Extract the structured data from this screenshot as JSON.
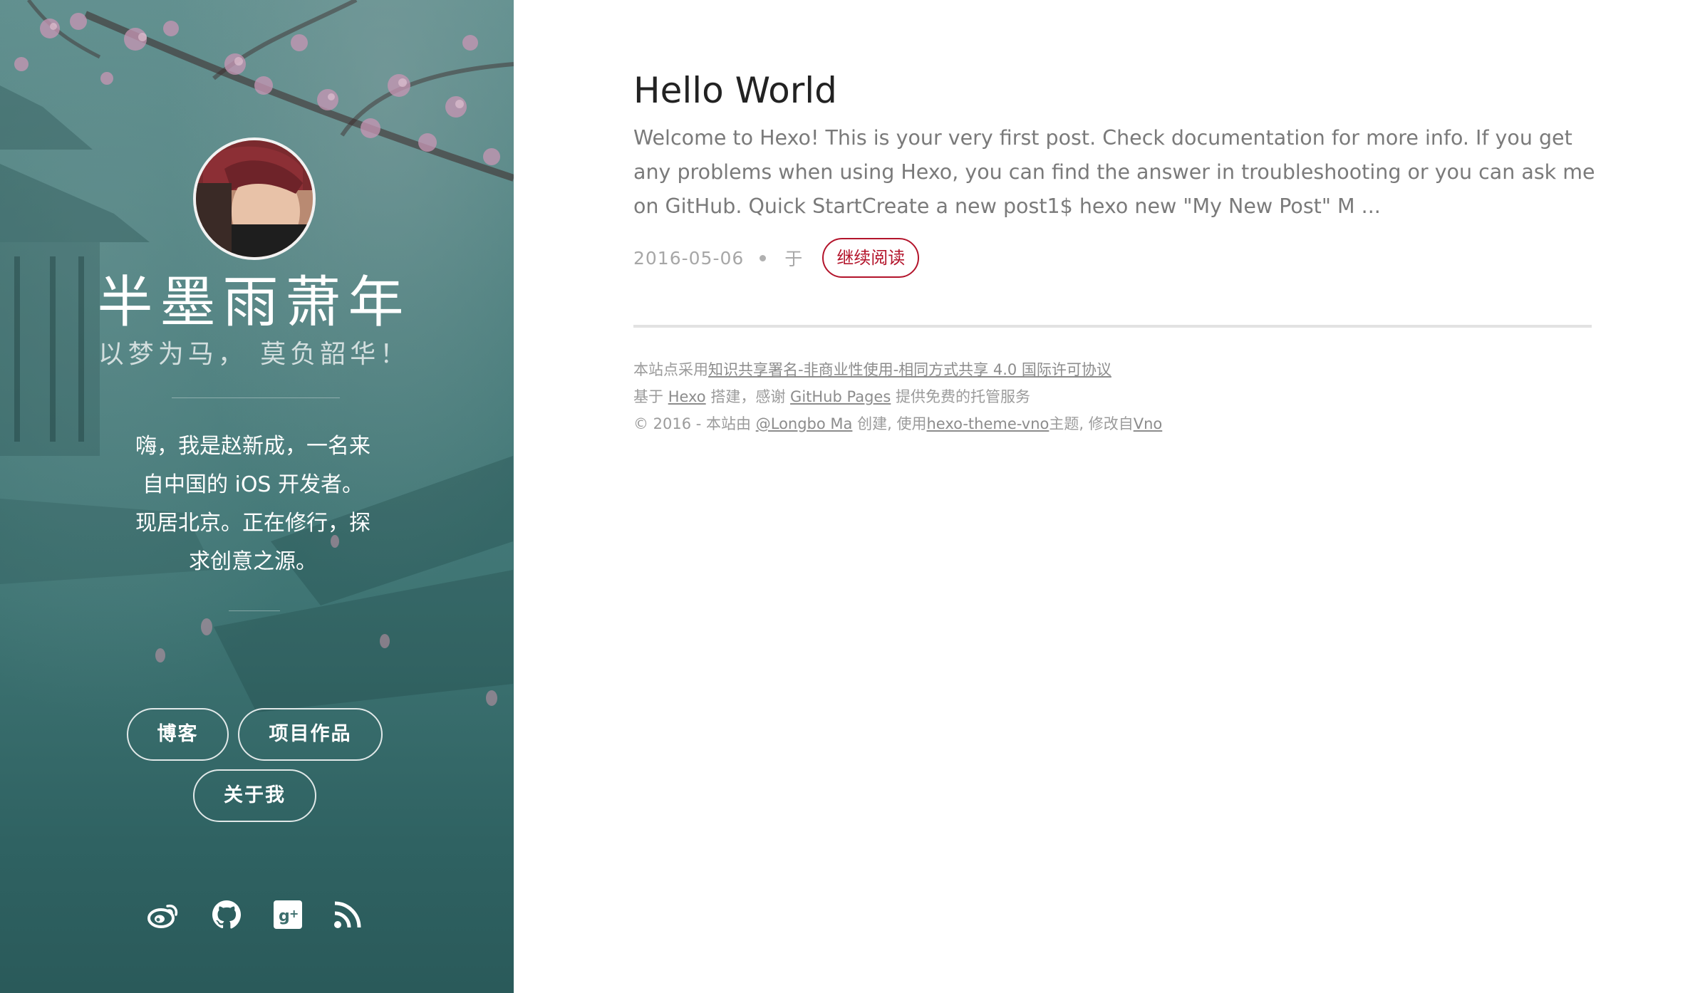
{
  "sidebar": {
    "title": "半墨雨萧年",
    "subtitle": "以梦为马， 莫负韶华！",
    "bio_lines": [
      "嗨，我是赵新成，一名来",
      "自中国的 iOS 开发者。",
      "现居北京。正在修行，探",
      "求创意之源。"
    ],
    "nav": {
      "blog": "博客",
      "projects": "项目作品",
      "about": "关于我"
    },
    "social_icons": [
      "weibo-icon",
      "github-icon",
      "google-plus-icon",
      "rss-icon"
    ]
  },
  "post": {
    "title": "Hello World",
    "excerpt": "Welcome to Hexo! This is your very first post. Check documentation for more info. If you get any problems when using Hexo, you can find the answer in troubleshooting or you can ask me on GitHub. Quick StartCreate a new post1$ hexo new \"My New Post\" M ...",
    "date": "2016-05-06",
    "in_label": "于",
    "read_more": "继续阅读"
  },
  "footer": {
    "line1_prefix": "本站点采用",
    "license_link": "知识共享署名-非商业性使用-相同方式共享 4.0 国际许可协议",
    "line2_prefix": "基于",
    "hexo_link": "Hexo",
    "line2_middle": "搭建，感谢",
    "github_pages_link": "GitHub Pages",
    "line2_suffix": "提供免费的托管服务",
    "line3_prefix": "© 2016 - 本站由",
    "author_link": "@Longbo Ma",
    "line3_middle": "创建, 使用",
    "theme_link": "hexo-theme-vno",
    "line3_middle2": "主题, 修改自",
    "vno_link": "Vno"
  },
  "colors": {
    "sidebar_teal": "#4d807f",
    "accent_red": "#b3142b",
    "title_text": "#222222",
    "body_text": "#7a7a7a"
  }
}
